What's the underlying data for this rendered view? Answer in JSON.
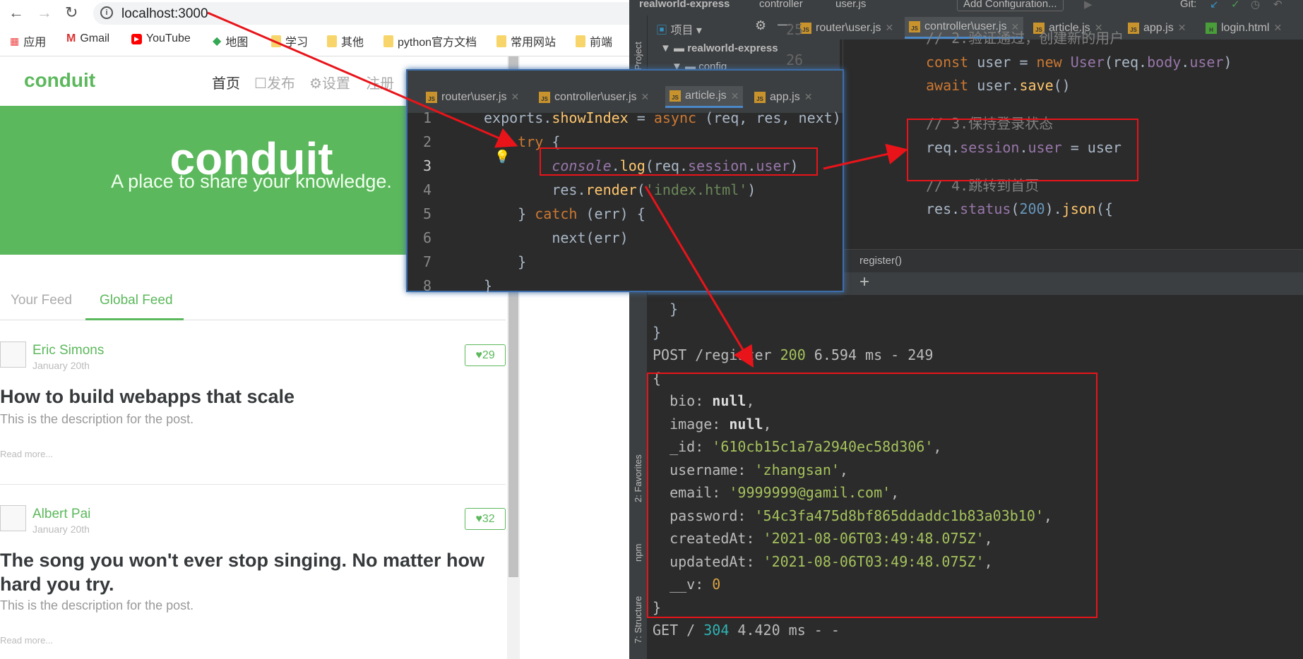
{
  "browser": {
    "url": "localhost:3000",
    "bookmarks": [
      "应用",
      "Gmail",
      "YouTube",
      "地图",
      "学习",
      "其他",
      "python官方文档",
      "常用网站",
      "前端"
    ]
  },
  "site": {
    "logo": "conduit",
    "nav": [
      "首页",
      "发布",
      "设置",
      "注册"
    ],
    "banner_title": "conduit",
    "banner_subtitle": "A place to share your knowledge.",
    "tabs": [
      "Your Feed",
      "Global Feed"
    ],
    "articles": [
      {
        "author": "Eric Simons",
        "date": "January 20th",
        "likes": "29",
        "title": "How to build webapps that scale",
        "description": "This is the description for the post.",
        "read_more": "Read more..."
      },
      {
        "author": "Albert Pai",
        "date": "January 20th",
        "likes": "32",
        "title": "The song you won't ever stop singing. No matter how hard you try.",
        "description": "This is the description for the post.",
        "read_more": "Read more..."
      }
    ]
  },
  "accent": "#5cb85c",
  "ide": {
    "breadcrumb": [
      "realworld-express",
      "controller",
      "user.js"
    ],
    "add_config": "Add Configuration...",
    "git_label": "Git:",
    "project_label": "项目",
    "tree": [
      "realworld-express",
      "config"
    ],
    "side_tools": [
      "1: Project",
      "2: Favorites",
      "npm",
      "7: Structure"
    ],
    "tabs": [
      {
        "name": "router\\user.js",
        "type": "js"
      },
      {
        "name": "controller\\user.js",
        "type": "js",
        "active": true
      },
      {
        "name": "article.js",
        "type": "js"
      },
      {
        "name": "app.js",
        "type": "js"
      },
      {
        "name": "login.html",
        "type": "html"
      }
    ],
    "line_numbers": [
      "25",
      "26"
    ],
    "code": [
      [
        [
          "// 2.验证通过，创建新的用户",
          "c"
        ]
      ],
      [
        [
          "const ",
          "k"
        ],
        [
          "user = ",
          "t0"
        ],
        [
          "new ",
          "k"
        ],
        [
          "User",
          "p"
        ],
        [
          "(req.",
          "t0"
        ],
        [
          "body",
          "p"
        ],
        [
          ".",
          "t0"
        ],
        [
          "user",
          "p"
        ],
        [
          ")",
          "t0"
        ]
      ],
      [
        [
          "await ",
          "k"
        ],
        [
          "user.",
          "t0"
        ],
        [
          "save",
          "f"
        ],
        [
          "()",
          "t0"
        ]
      ],
      [],
      [
        [
          "// 3.保持登录状态",
          "c"
        ]
      ],
      [
        [
          "req.",
          "t0"
        ],
        [
          "session",
          "p"
        ],
        [
          ".",
          "t0"
        ],
        [
          "user",
          "p"
        ],
        [
          " = user",
          "t0"
        ]
      ],
      [],
      [
        [
          "// 4.跳转到首页",
          "c"
        ]
      ],
      [
        [
          "res.",
          "t0"
        ],
        [
          "status",
          "p"
        ],
        [
          "(",
          "t0"
        ],
        [
          "200",
          "n"
        ],
        [
          ").",
          "t0"
        ],
        [
          "json",
          "f"
        ],
        [
          "({",
          "t0"
        ]
      ]
    ],
    "function_crumb": "register()",
    "console": [
      [
        [
          "  }",
          "t0"
        ]
      ],
      [
        [
          "}",
          "t0"
        ]
      ],
      [
        [
          "POST /register ",
          ""
        ],
        [
          "200",
          "c200"
        ],
        [
          " 6.594 ms - 249",
          ""
        ]
      ],
      [
        [
          "{",
          ""
        ]
      ],
      [
        [
          "  bio: ",
          ""
        ],
        [
          "null",
          "bold"
        ],
        [
          ",",
          ""
        ]
      ],
      [
        [
          "  image: ",
          ""
        ],
        [
          "null",
          "bold"
        ],
        [
          ",",
          ""
        ]
      ],
      [
        [
          "  _id: ",
          ""
        ],
        [
          "'610cb15c1a7a2940ec58d306'",
          "cs"
        ],
        [
          ",",
          ""
        ]
      ],
      [
        [
          "  username: ",
          ""
        ],
        [
          "'zhangsan'",
          "cs"
        ],
        [
          ",",
          ""
        ]
      ],
      [
        [
          "  email: ",
          ""
        ],
        [
          "'9999999@gamil.com'",
          "cs"
        ],
        [
          ",",
          ""
        ]
      ],
      [
        [
          "  password: ",
          ""
        ],
        [
          "'54c3fa475d8bf865ddaddc1b83a03b10'",
          "cs"
        ],
        [
          ",",
          ""
        ]
      ],
      [
        [
          "  createdAt: ",
          ""
        ],
        [
          "'2021-08-06T03:49:48.075Z'",
          "cs"
        ],
        [
          ",",
          ""
        ]
      ],
      [
        [
          "  updatedAt: ",
          ""
        ],
        [
          "'2021-08-06T03:49:48.075Z'",
          "cs"
        ],
        [
          ",",
          ""
        ]
      ],
      [
        [
          "  __v: ",
          ""
        ],
        [
          "0",
          "c0"
        ]
      ],
      [
        [
          "}",
          ""
        ]
      ],
      [
        [
          "GET / ",
          ""
        ],
        [
          "304",
          "c304"
        ],
        [
          " 4.420 ms - -",
          ""
        ]
      ]
    ]
  },
  "popup": {
    "tabs": [
      {
        "name": "router\\user.js",
        "type": "js"
      },
      {
        "name": "controller\\user.js",
        "type": "js"
      },
      {
        "name": "article.js",
        "type": "js",
        "active": true
      },
      {
        "name": "app.js",
        "type": "js"
      }
    ],
    "line_numbers": [
      "1",
      "2",
      "3",
      "4",
      "5",
      "6",
      "7",
      "8"
    ],
    "code": [
      [
        [
          "exports.",
          "t0"
        ],
        [
          "showIndex",
          "f"
        ],
        [
          " = ",
          "t0"
        ],
        [
          "async ",
          "k"
        ],
        [
          "(req, res, next)",
          "t0"
        ]
      ],
      [
        [
          "    ",
          "t0"
        ],
        [
          "try ",
          "k"
        ],
        [
          "{",
          "t0"
        ]
      ],
      [
        [
          "        ",
          "t0"
        ],
        [
          "console",
          "it"
        ],
        [
          ".",
          "t0"
        ],
        [
          "log",
          "f"
        ],
        [
          "(req.",
          "t0"
        ],
        [
          "session",
          "p"
        ],
        [
          ".",
          "t0"
        ],
        [
          "user",
          "p"
        ],
        [
          ")",
          "t0"
        ]
      ],
      [
        [
          "        res.",
          "t0"
        ],
        [
          "render",
          "f"
        ],
        [
          "(",
          "t0"
        ],
        [
          "'index.html'",
          "s"
        ],
        [
          ")",
          "t0"
        ]
      ],
      [
        [
          "    } ",
          "t0"
        ],
        [
          "catch ",
          "k"
        ],
        [
          "(err) {",
          "t0"
        ]
      ],
      [
        [
          "        next(err)",
          "t0"
        ]
      ],
      [
        [
          "    }",
          "t0"
        ]
      ],
      [
        [
          "}",
          "t0"
        ]
      ]
    ]
  }
}
